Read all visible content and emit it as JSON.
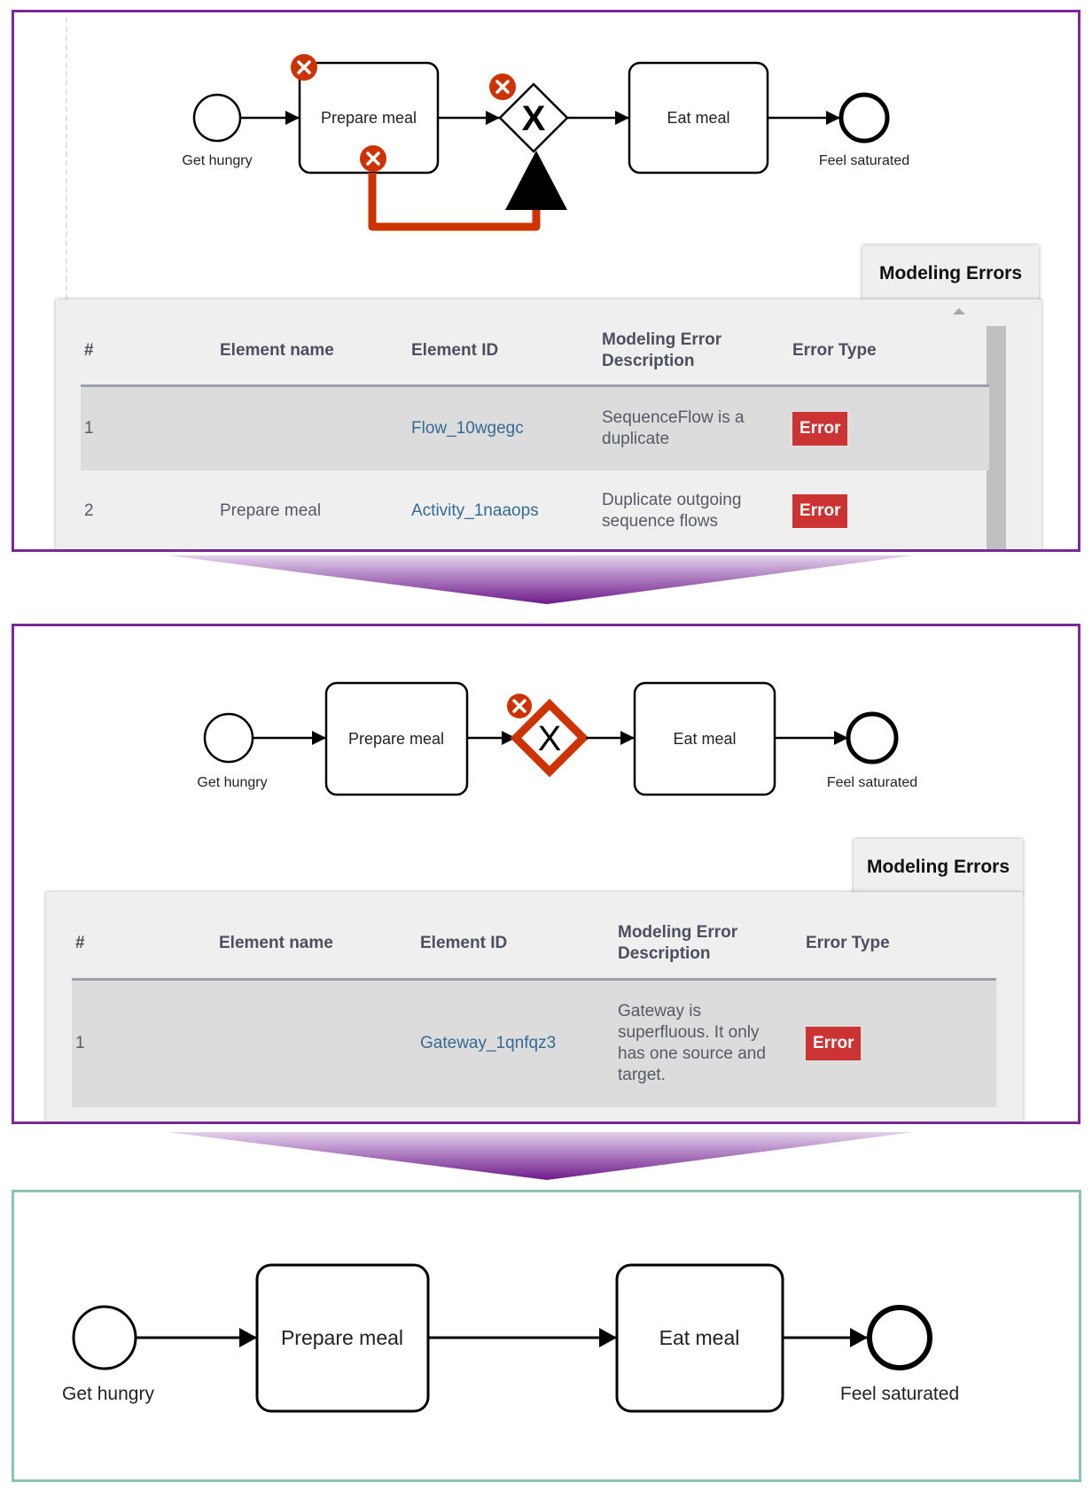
{
  "colors": {
    "panel_border_purple": "#7a2a98",
    "panel_border_teal": "#8cc4b4",
    "error_red": "#cc3333",
    "marker_red": "#cc3300",
    "link_blue": "#356a94"
  },
  "panels": [
    {
      "diagram": {
        "start_event": "Get hungry",
        "task_1": "Prepare meal",
        "gateway_symbol": "X",
        "task_2": "Eat meal",
        "end_event": "Feel saturated",
        "error_markers": [
          "task-1-top-left",
          "task-1-bottom",
          "gateway"
        ],
        "highlighted_flow": "duplicate sequence flow Prepare meal to gateway"
      },
      "errors_tab": "Modeling Errors",
      "table": {
        "headers": [
          "#",
          "Element name",
          "Element ID",
          "Modeling Error Description",
          "Error Type"
        ],
        "header_desc_lines": [
          "Modeling Error",
          "Description"
        ],
        "rows": [
          {
            "num": "1",
            "name": "",
            "id": "Flow_10wgegc",
            "desc_lines": [
              "SequenceFlow is a",
              "duplicate"
            ],
            "type": "Error"
          },
          {
            "num": "2",
            "name": "Prepare meal",
            "id": "Activity_1naaops",
            "desc_lines": [
              "Duplicate outgoing",
              "sequence flows"
            ],
            "type": "Error"
          }
        ]
      }
    },
    {
      "diagram": {
        "start_event": "Get hungry",
        "task_1": "Prepare meal",
        "gateway_symbol": "X",
        "task_2": "Eat meal",
        "end_event": "Feel saturated",
        "error_markers": [
          "gateway"
        ]
      },
      "errors_tab": "Modeling Errors",
      "table": {
        "headers": [
          "#",
          "Element name",
          "Element ID",
          "Modeling Error Description",
          "Error Type"
        ],
        "header_desc_lines": [
          "Modeling Error",
          "Description"
        ],
        "rows": [
          {
            "num": "1",
            "name": "",
            "id": "Gateway_1qnfqz3",
            "desc_lines": [
              "Gateway is",
              "superfluous. It only",
              "has one source and",
              "target."
            ],
            "type": "Error"
          }
        ]
      }
    },
    {
      "diagram": {
        "start_event": "Get hungry",
        "task_1": "Prepare meal",
        "task_2": "Eat meal",
        "end_event": "Feel saturated"
      }
    }
  ]
}
